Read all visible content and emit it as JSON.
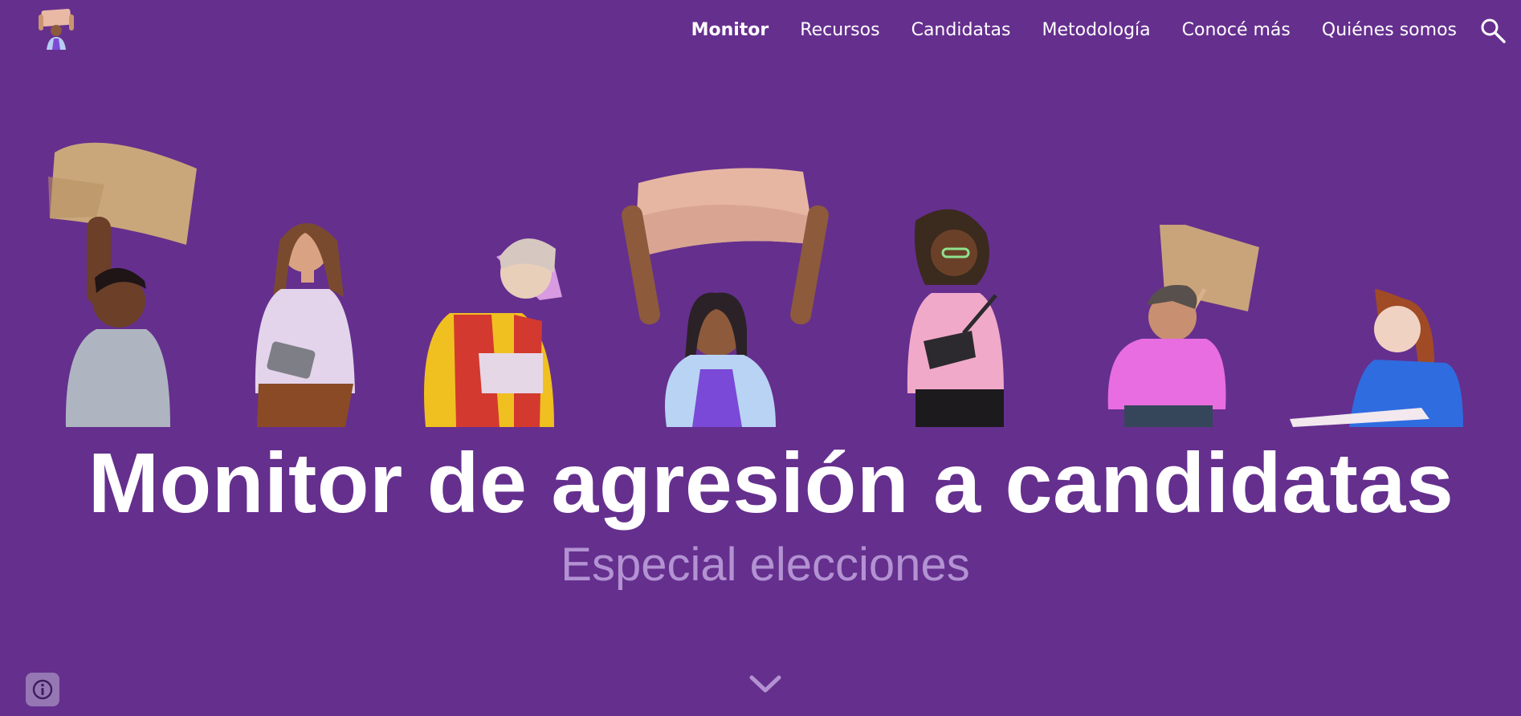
{
  "nav": {
    "items": [
      {
        "label": "Monitor",
        "active": true
      },
      {
        "label": "Recursos",
        "active": false
      },
      {
        "label": "Candidatas",
        "active": false
      },
      {
        "label": "Metodología",
        "active": false
      },
      {
        "label": "Conocé más",
        "active": false
      },
      {
        "label": "Quiénes somos",
        "active": false
      }
    ],
    "search_icon": "search-icon"
  },
  "hero": {
    "title": "Monitor de agresión a candidatas",
    "subtitle": "Especial elecciones",
    "scroll_icon": "chevron-down-icon"
  },
  "footer": {
    "info_icon": "info-icon"
  },
  "colors": {
    "background": "#652f8e",
    "subtitle": "#b392d2",
    "text": "#ffffff"
  }
}
